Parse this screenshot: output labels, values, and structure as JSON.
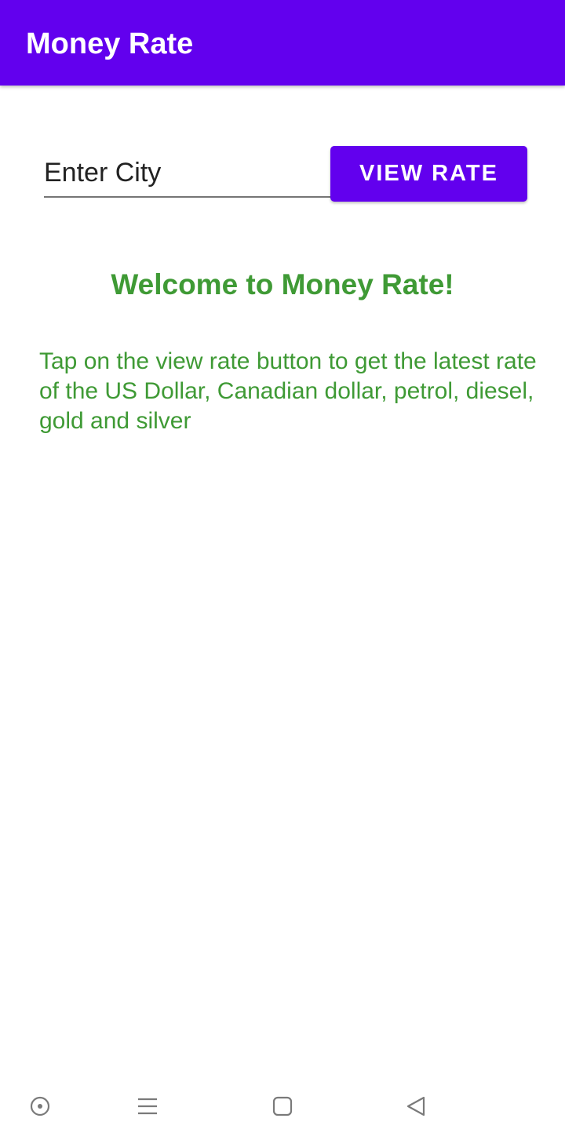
{
  "app_bar": {
    "title": "Money Rate",
    "color": "#6200ee"
  },
  "city_input": {
    "placeholder": "Enter City",
    "value": ""
  },
  "view_rate_button": {
    "label": "VIEW RATE"
  },
  "welcome": {
    "heading": "Welcome to Money Rate!",
    "description": "Tap on the view rate button to get the latest rate of the US Dollar, Canadian dollar, petrol, diesel, gold and silver",
    "color": "#3f9a35"
  },
  "nav_bar": {
    "icons": [
      "assistant-circle-icon",
      "recent-apps-lines-icon",
      "home-square-icon",
      "back-triangle-icon"
    ]
  }
}
